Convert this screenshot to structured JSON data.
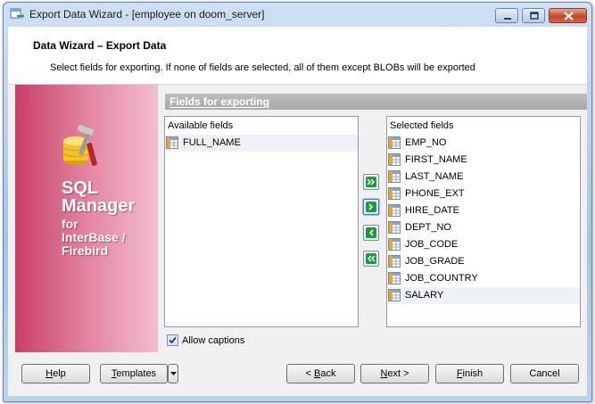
{
  "window": {
    "title": "Export Data Wizard - [employee on doom_server]"
  },
  "header": {
    "title": "Data Wizard – Export Data",
    "description": "Select fields for exporting. If none of fields are selected, all of them except BLOBs will be exported"
  },
  "banner": {
    "line1": "SQL",
    "line2": "Manager",
    "line3": "for",
    "line4": "InterBase /",
    "line5": "Firebird"
  },
  "section": {
    "title": "Fields for exporting"
  },
  "available": {
    "label": "Available fields",
    "items": [
      "FULL_NAME"
    ]
  },
  "selected": {
    "label": "Selected fields",
    "items": [
      "EMP_NO",
      "FIRST_NAME",
      "LAST_NAME",
      "PHONE_EXT",
      "HIRE_DATE",
      "DEPT_NO",
      "JOB_CODE",
      "JOB_GRADE",
      "JOB_COUNTRY",
      "SALARY"
    ]
  },
  "options": {
    "allow_captions_label": "Allow captions",
    "allow_captions_checked": true
  },
  "buttons": {
    "help": "Help",
    "templates": "Templates",
    "back": "< Back",
    "next": "Next >",
    "finish": "Finish",
    "cancel": "Cancel"
  },
  "colors": {
    "banner_start": "#c93f68",
    "banner_end": "#f2bdcd",
    "arrow_green": "#1f9a3a",
    "section_bar": "#a8a8a8"
  },
  "icons": {
    "field": "table-field-icon",
    "move_all_right": "double-chevron-right-icon",
    "move_right": "chevron-right-icon",
    "move_left": "chevron-left-icon",
    "move_all_left": "double-chevron-left-icon"
  }
}
